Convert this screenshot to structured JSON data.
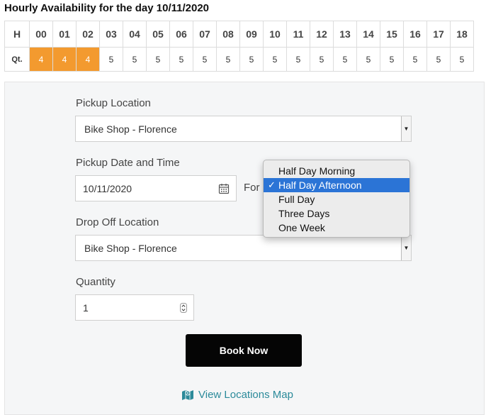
{
  "title": "Hourly Availability for the day 10/11/2020",
  "availability": {
    "hour_header": "H",
    "qty_header": "Qt.",
    "hours": [
      "00",
      "01",
      "02",
      "03",
      "04",
      "05",
      "06",
      "07",
      "08",
      "09",
      "10",
      "11",
      "12",
      "13",
      "14",
      "15",
      "16",
      "17",
      "18"
    ],
    "quantities": [
      "4",
      "4",
      "4",
      "5",
      "5",
      "5",
      "5",
      "5",
      "5",
      "5",
      "5",
      "5",
      "5",
      "5",
      "5",
      "5",
      "5",
      "5",
      "5"
    ],
    "highlight_color": "#f39a2f"
  },
  "form": {
    "pickup_location_label": "Pickup Location",
    "pickup_location_value": "Bike Shop - Florence",
    "pickup_datetime_label": "Pickup Date and Time",
    "pickup_date_value": "10/11/2020",
    "for_label": "For",
    "duration_options": [
      "Half Day Morning",
      "Half Day Afternoon",
      "Full Day",
      "Three Days",
      "One Week"
    ],
    "duration_selected": "Half Day Afternoon",
    "dropoff_location_label": "Drop Off Location",
    "dropoff_location_value": "Bike Shop - Florence",
    "quantity_label": "Quantity",
    "quantity_value": "1",
    "book_button": "Book Now",
    "map_link": "View Locations Map"
  },
  "icons": {
    "date_picker": "calendar-icon",
    "quantity": "stepper-icon",
    "map": "map-icon",
    "dropdown_arrow": "chevron-down-icon",
    "selected_option": "checkmark-icon"
  }
}
